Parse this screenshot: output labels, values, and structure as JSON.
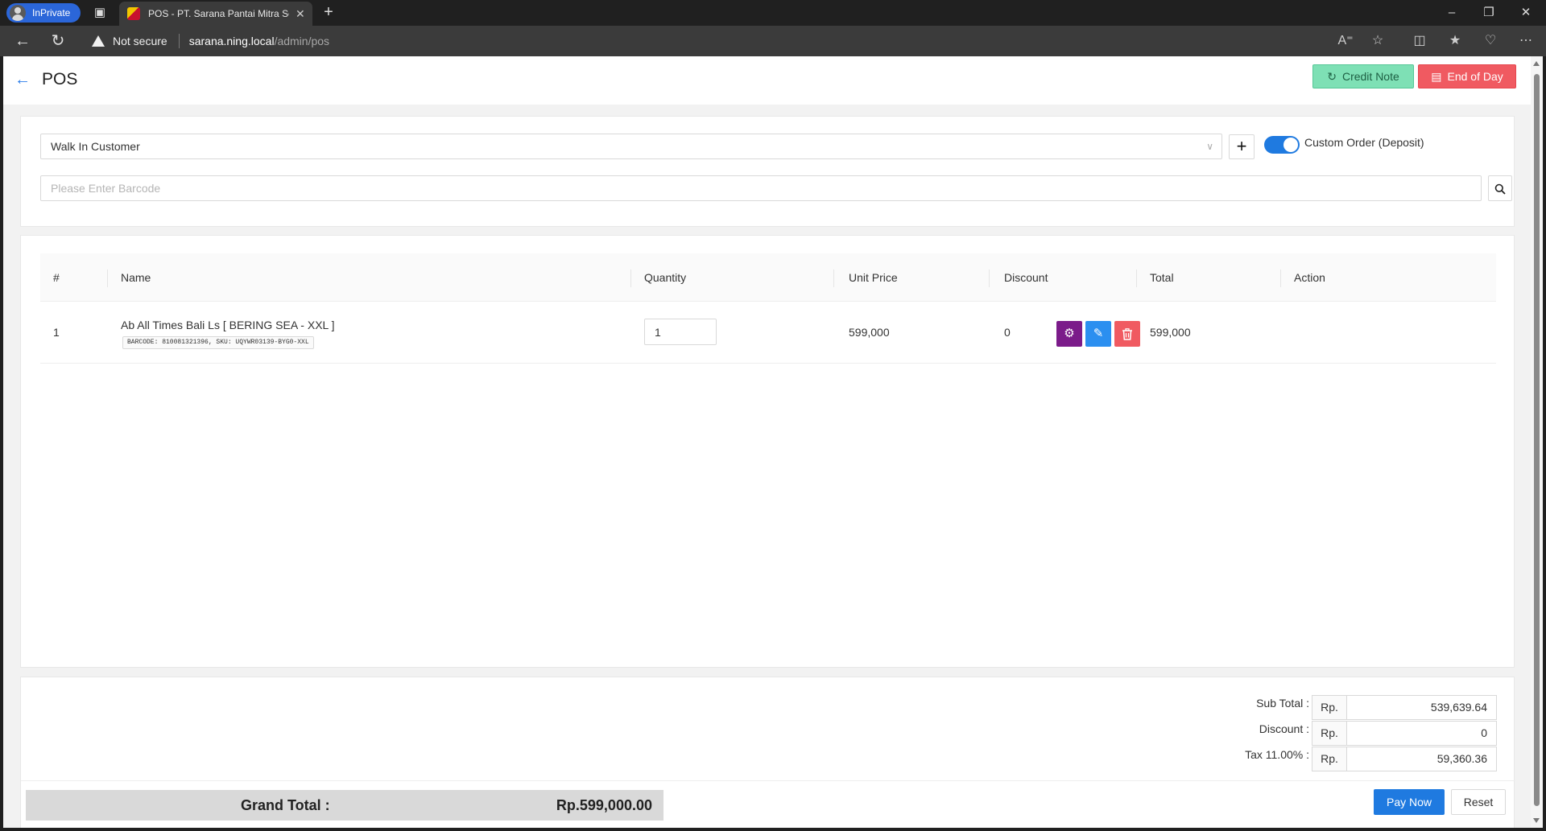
{
  "browser": {
    "inprivate_label": "InPrivate",
    "tab_title": "POS - PT. Sarana Pantai Mitra Se",
    "not_secure": "Not secure",
    "url_host": "sarana.ning.local",
    "url_path": "/admin/pos"
  },
  "header": {
    "title": "POS",
    "credit_note_label": "Credit Note",
    "end_of_day_label": "End of Day"
  },
  "customer": {
    "selected": "Walk In Customer",
    "custom_order_label": "Custom Order (Deposit)",
    "custom_order_enabled": true
  },
  "barcode": {
    "placeholder": "Please Enter Barcode"
  },
  "table": {
    "columns": {
      "index": "#",
      "name": "Name",
      "quantity": "Quantity",
      "unit_price": "Unit Price",
      "discount": "Discount",
      "total": "Total",
      "action": "Action"
    },
    "rows": [
      {
        "index": "1",
        "name": "Ab All Times Bali Ls [ BERING SEA - XXL ]",
        "meta": "BARCODE: 810081321396, SKU: UQYWR03139-BYG0-XXL",
        "quantity": "1",
        "unit_price": "599,000",
        "discount": "0",
        "total": "599,000"
      }
    ]
  },
  "summary": {
    "currency": "Rp.",
    "sub_total_label": "Sub Total :",
    "sub_total": "539,639.64",
    "discount_label": "Discount :",
    "discount": "0",
    "tax_label": "Tax 11.00% :",
    "tax": "59,360.36",
    "grand_total_label": "Grand Total :",
    "grand_total": "Rp.599,000.00"
  },
  "actions": {
    "pay_now_label": "Pay Now",
    "reset_label": "Reset"
  },
  "colors": {
    "primary": "#1f7ae0",
    "credit_note": "#7ee0b5",
    "end_of_day": "#f05a61",
    "settings_action": "#7b1b8a"
  }
}
